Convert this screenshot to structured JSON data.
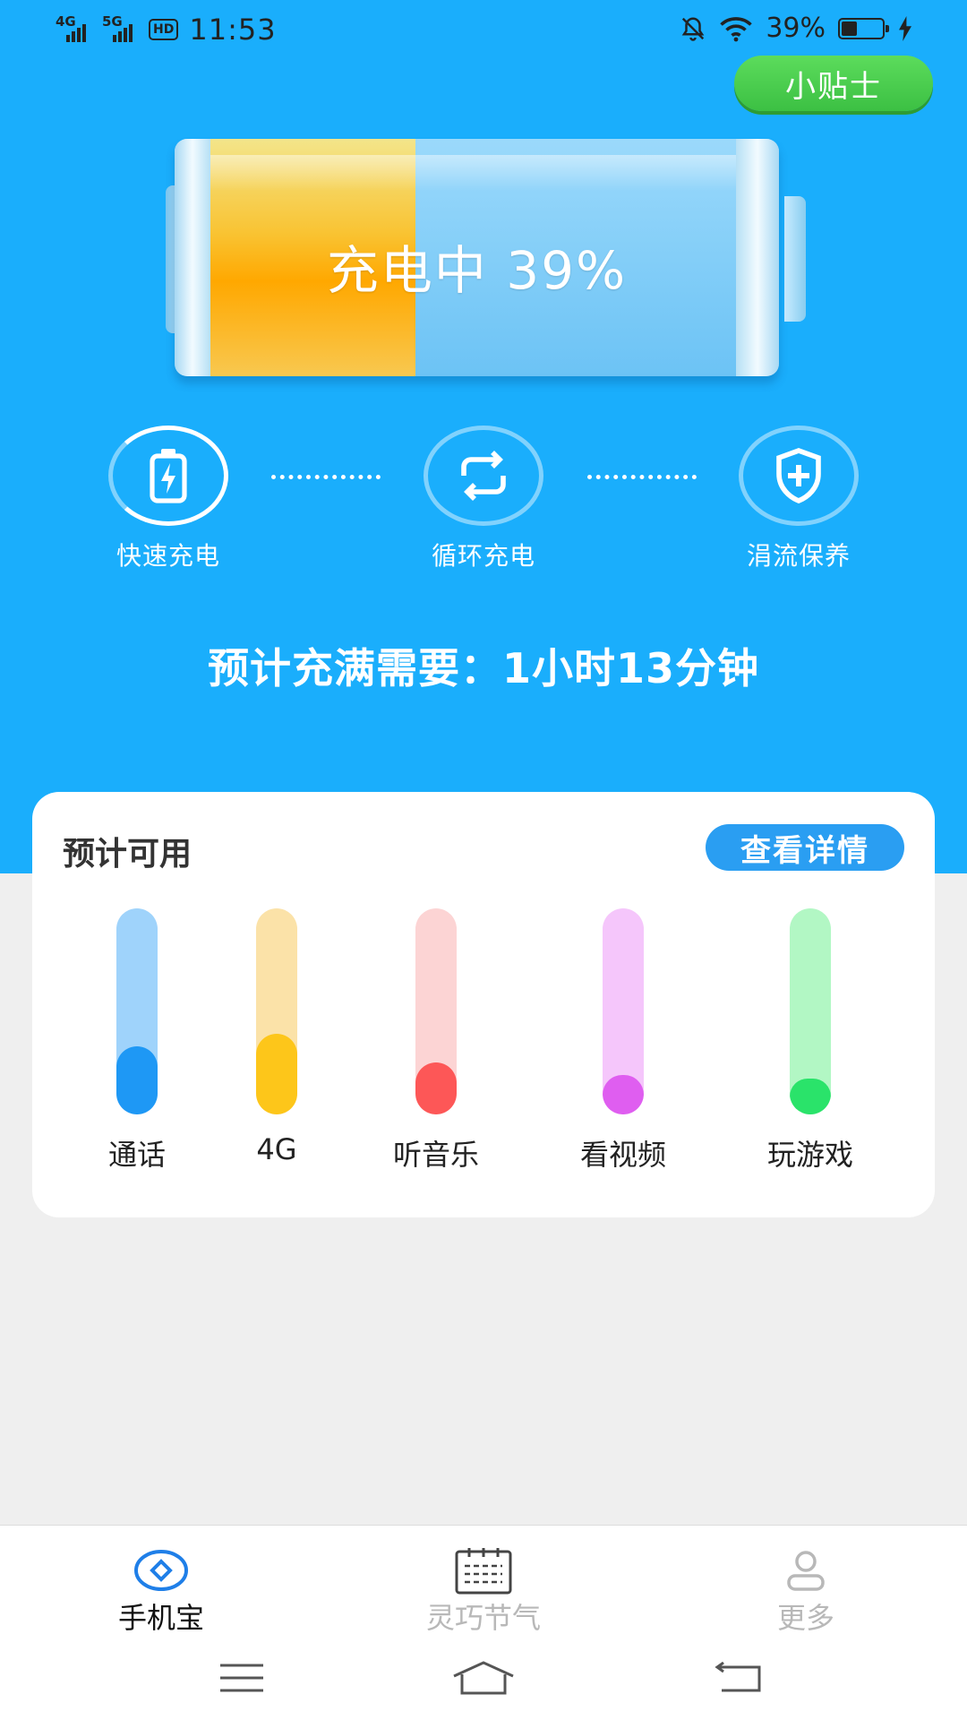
{
  "status_bar": {
    "net1": "4G",
    "net2": "5G",
    "hd": "HD",
    "time": "11:53",
    "battery_text": "39%",
    "battery_level": 0.39
  },
  "tips_button": "小贴士",
  "battery": {
    "label": "充电中 39%",
    "level": 0.39
  },
  "modes": [
    {
      "label": "快速充电",
      "icon": "battery-bolt-icon",
      "active": true
    },
    {
      "label": "循环充电",
      "icon": "cycle-icon",
      "active": false
    },
    {
      "label": "涓流保养",
      "icon": "shield-plus-icon",
      "active": false
    }
  ],
  "eta": "预计充满需要：1小时13分钟",
  "card": {
    "title": "预计可用",
    "details_button": "查看详情",
    "items": [
      {
        "label": "通话",
        "level": 0.33,
        "track": "#9fd3fb",
        "fill": "#1e98f5"
      },
      {
        "label": "4G",
        "level": 0.39,
        "track": "#fbe2a8",
        "fill": "#fdc61a"
      },
      {
        "label": "听音乐",
        "level": 0.25,
        "track": "#fcd4d4",
        "fill": "#fd5757"
      },
      {
        "label": "看视频",
        "level": 0.19,
        "track": "#f5c6fb",
        "fill": "#df5ef0"
      },
      {
        "label": "玩游戏",
        "level": 0.16,
        "track": "#b2f7c4",
        "fill": "#2ae36a"
      }
    ]
  },
  "tabs": [
    {
      "label": "手机宝",
      "icon": "diamond-circle-icon",
      "active": true
    },
    {
      "label": "灵巧节气",
      "icon": "calendar-icon",
      "active": false
    },
    {
      "label": "更多",
      "icon": "user-icon",
      "active": false
    }
  ],
  "colors": {
    "hero_bg": "#1aaefc",
    "accent_green": "#3cc043",
    "accent_blue": "#2a9ef2",
    "tab_active": "#1f7fe8",
    "tab_inactive": "#b8b8b8"
  }
}
